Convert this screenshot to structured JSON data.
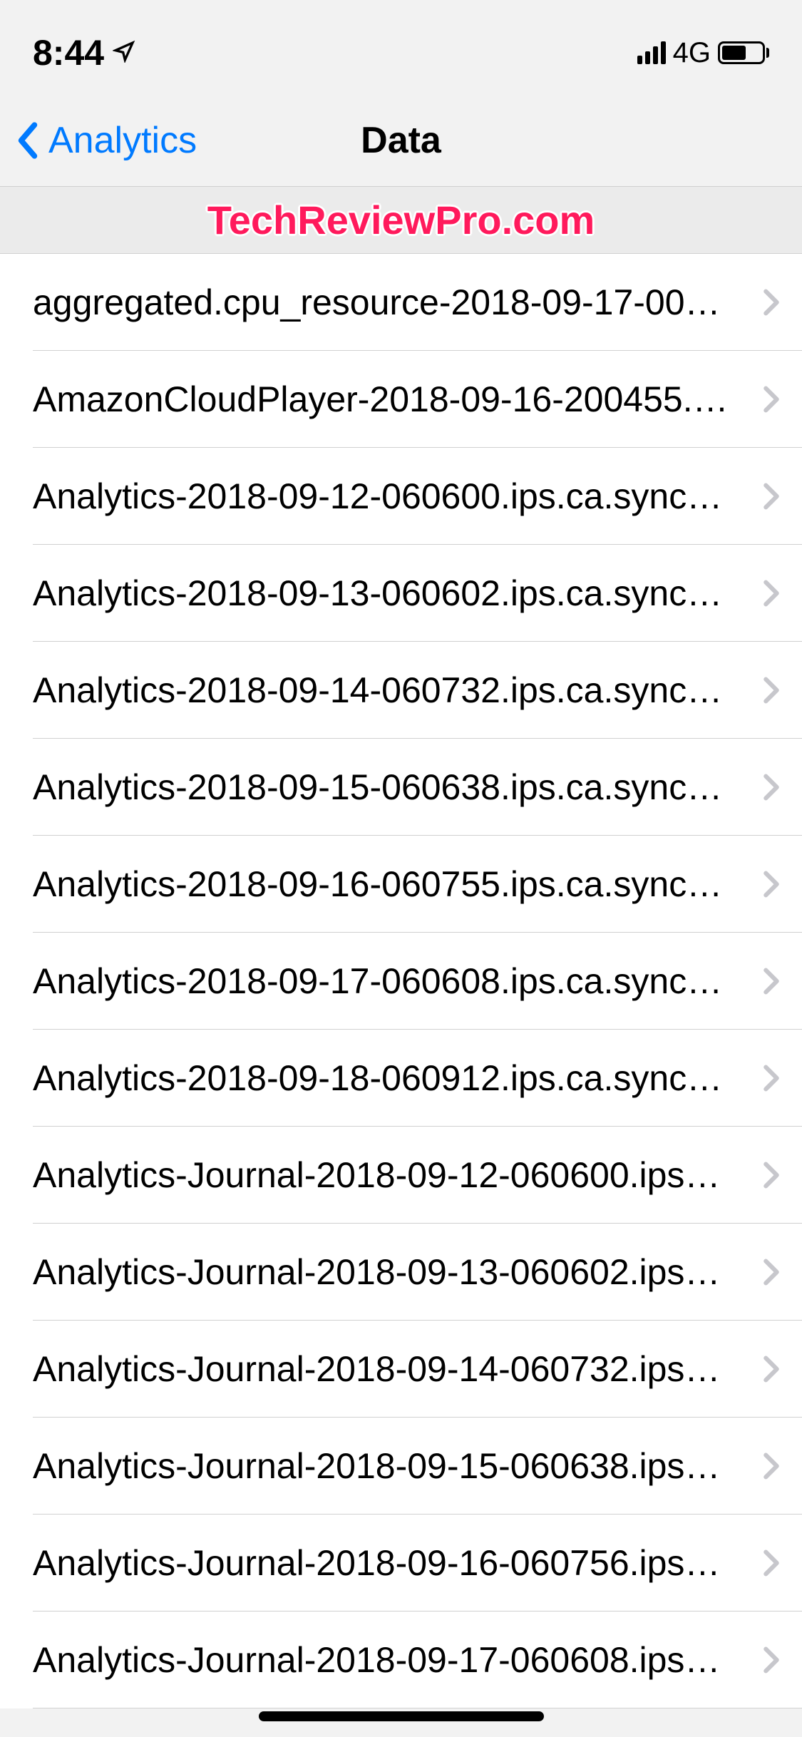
{
  "statusBar": {
    "time": "8:44",
    "networkType": "4G"
  },
  "navBar": {
    "backLabel": "Analytics",
    "title": "Data"
  },
  "watermark": "TechReviewPro.com",
  "list": {
    "items": [
      {
        "label": "aggregated.cpu_resource-2018-09-17-00…"
      },
      {
        "label": "AmazonCloudPlayer-2018-09-16-200455.…"
      },
      {
        "label": "Analytics-2018-09-12-060600.ips.ca.sync…"
      },
      {
        "label": "Analytics-2018-09-13-060602.ips.ca.sync…"
      },
      {
        "label": "Analytics-2018-09-14-060732.ips.ca.sync…"
      },
      {
        "label": "Analytics-2018-09-15-060638.ips.ca.sync…"
      },
      {
        "label": "Analytics-2018-09-16-060755.ips.ca.sync…"
      },
      {
        "label": "Analytics-2018-09-17-060608.ips.ca.sync…"
      },
      {
        "label": "Analytics-2018-09-18-060912.ips.ca.sync…"
      },
      {
        "label": "Analytics-Journal-2018-09-12-060600.ips…"
      },
      {
        "label": "Analytics-Journal-2018-09-13-060602.ips…"
      },
      {
        "label": "Analytics-Journal-2018-09-14-060732.ips…"
      },
      {
        "label": "Analytics-Journal-2018-09-15-060638.ips…"
      },
      {
        "label": "Analytics-Journal-2018-09-16-060756.ips…"
      },
      {
        "label": "Analytics-Journal-2018-09-17-060608.ips…"
      }
    ]
  }
}
